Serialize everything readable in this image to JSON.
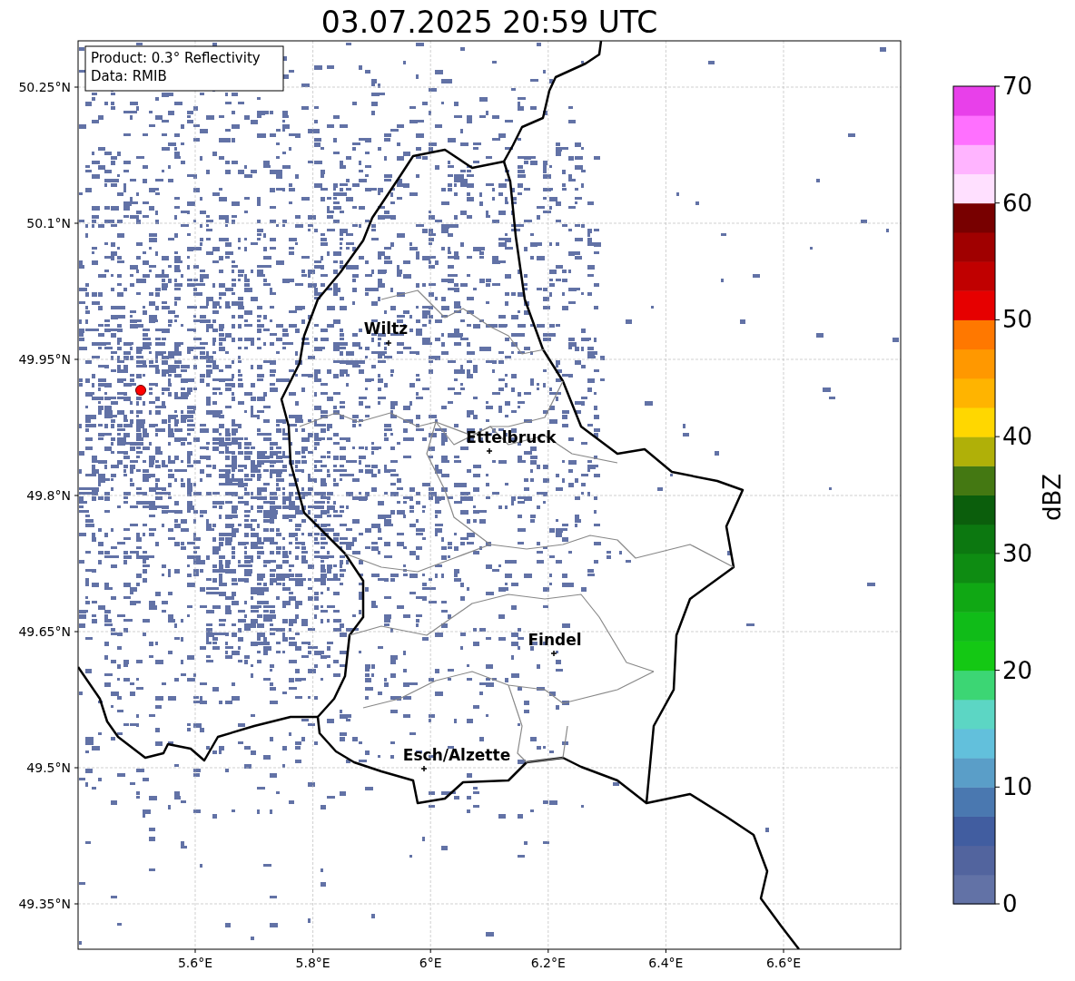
{
  "title": "03.07.2025 20:59 UTC",
  "info_box": [
    "Product: 0.3° Reflectivity",
    "Data: RMIB"
  ],
  "map": {
    "x_ticks": [
      "5.6°E",
      "5.8°E",
      "6°E",
      "6.2°E",
      "6.4°E",
      "6.6°E"
    ],
    "y_ticks": [
      "50.25°N",
      "50.1°N",
      "49.95°N",
      "49.8°N",
      "49.65°N",
      "49.5°N",
      "49.35°N"
    ],
    "cities": [
      {
        "name": "Wiltz"
      },
      {
        "name": "Ettelbruck"
      },
      {
        "name": "Findel"
      },
      {
        "name": "Esch/Alzette"
      }
    ]
  },
  "colorbar": {
    "label": "dBZ",
    "ticks": [
      "70",
      "60",
      "50",
      "40",
      "30",
      "20",
      "10",
      "0"
    ],
    "segments": [
      {
        "color": "#6272a6"
      },
      {
        "color": "#52649e"
      },
      {
        "color": "#415da0"
      },
      {
        "color": "#4a78b0"
      },
      {
        "color": "#5a9ec8"
      },
      {
        "color": "#62c0dc"
      },
      {
        "color": "#5cd6c4"
      },
      {
        "color": "#3cd674"
      },
      {
        "color": "#14c814"
      },
      {
        "color": "#10bc18"
      },
      {
        "color": "#10a814"
      },
      {
        "color": "#0e8c12"
      },
      {
        "color": "#0c7810"
      },
      {
        "color": "#0b5e0c"
      },
      {
        "color": "#447812"
      },
      {
        "color": "#b0b008"
      },
      {
        "color": "#ffd700"
      },
      {
        "color": "#ffb400"
      },
      {
        "color": "#ff9800"
      },
      {
        "color": "#ff7800"
      },
      {
        "color": "#e60000"
      },
      {
        "color": "#c00000"
      },
      {
        "color": "#a00000"
      },
      {
        "color": "#780000"
      },
      {
        "color": "#ffe0ff"
      },
      {
        "color": "#ffb4ff"
      },
      {
        "color": "#ff70ff"
      },
      {
        "color": "#e840ea"
      }
    ]
  }
}
